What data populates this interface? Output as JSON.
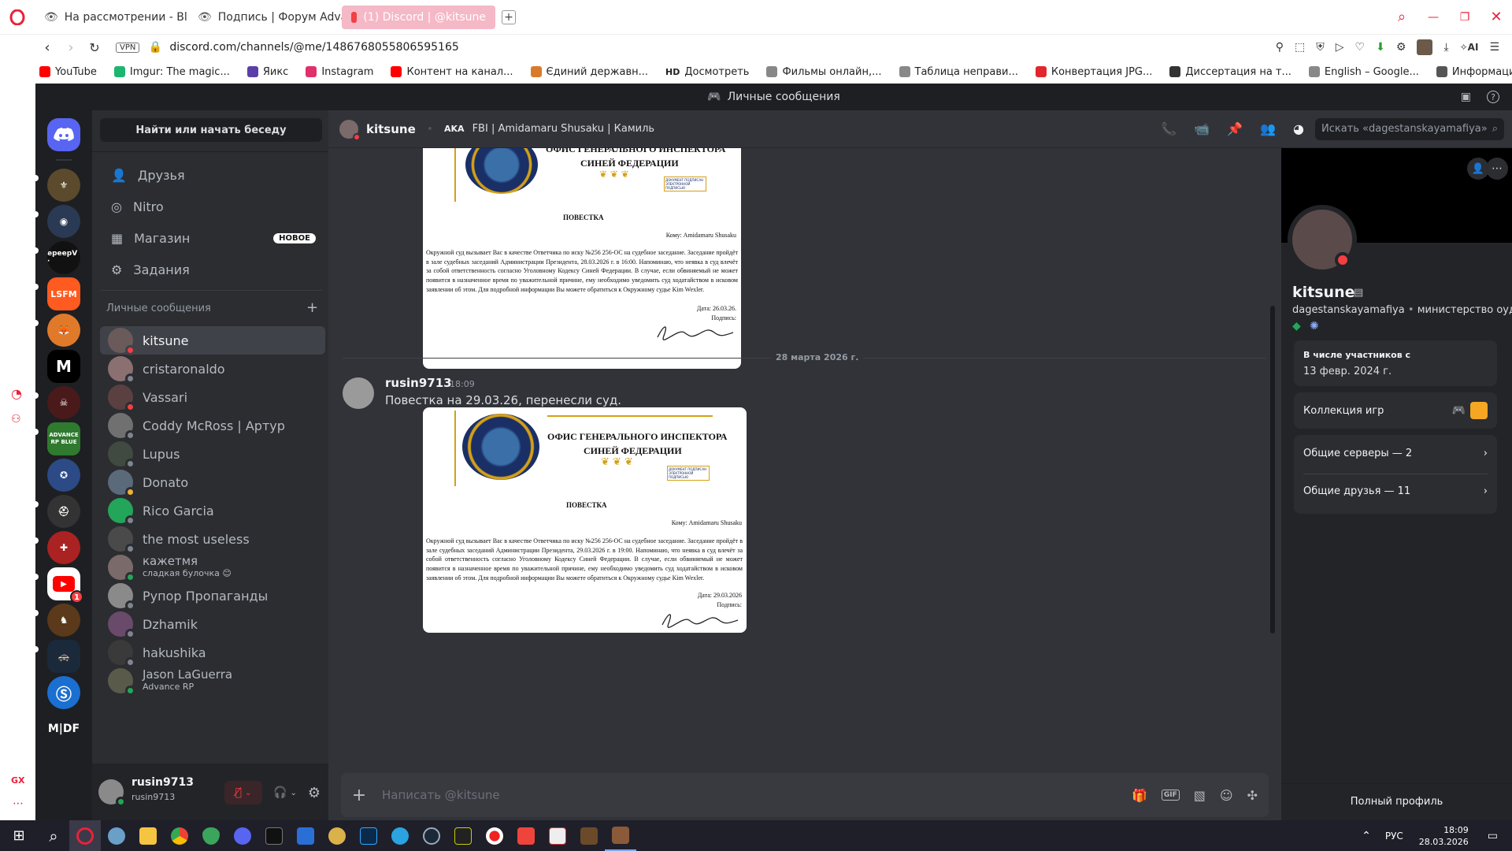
{
  "browser": {
    "tabs": [
      {
        "label": "На рассмотрении - Blue"
      },
      {
        "label": "Подпись | Форум Advanc"
      },
      {
        "label": "(1) Discord | @kitsune"
      }
    ],
    "url": "discord.com/channels/@me/1486768055806595165",
    "vpn": "VPN",
    "bookmarks": [
      {
        "label": "YouTube",
        "color": "#ff0000"
      },
      {
        "label": "Imgur: The magic...",
        "color": "#1bb76e"
      },
      {
        "label": "Яикс",
        "color": "#5b3fa8"
      },
      {
        "label": "Instagram",
        "color": "#e1306c"
      },
      {
        "label": "Контент на канал...",
        "color": "#ff0000"
      },
      {
        "label": "Єдиний державн...",
        "color": "#d97a2b"
      },
      {
        "label": "Досмотреть",
        "color": "#222222",
        "prefix": "HD"
      },
      {
        "label": "Фильмы онлайн,...",
        "color": "#888888"
      },
      {
        "label": "Таблица неправи...",
        "color": "#888888"
      },
      {
        "label": "Конвертация JPG...",
        "color": "#e2262c"
      },
      {
        "label": "Диссертация на т...",
        "color": "#333333"
      },
      {
        "label": "English – Google...",
        "color": "#888888"
      },
      {
        "label": "Информация об а...",
        "color": "#555555"
      }
    ],
    "ai_label": "AI",
    "gx_label": "GX"
  },
  "discord": {
    "window_title": "Личные сообщения",
    "search_placeholder": "Найти или начать беседу",
    "nav": [
      {
        "label": "Друзья",
        "icon": "friends-icon"
      },
      {
        "label": "Nitro",
        "icon": "nitro-icon"
      },
      {
        "label": "Магазин",
        "icon": "shop-icon",
        "badge": "НОВОЕ"
      },
      {
        "label": "Задания",
        "icon": "quests-icon"
      }
    ],
    "dm_header": "Личные сообщения",
    "dms": [
      {
        "name": "kitsune",
        "status": "dnd",
        "active": true
      },
      {
        "name": "cristaronaldo",
        "status": "offline"
      },
      {
        "name": "Vassari",
        "status": "dnd"
      },
      {
        "name": "Coddy McRoss | Артур",
        "status": "offline"
      },
      {
        "name": "Lupus",
        "status": "offline"
      },
      {
        "name": "Donato",
        "status": "idle"
      },
      {
        "name": "Rico Garcia",
        "status": "offline"
      },
      {
        "name": "the most useless",
        "status": "offline"
      },
      {
        "name": "кажетмя",
        "sub": "сладкая булочка 😊",
        "status": "online"
      },
      {
        "name": "Рупор Пропаганды",
        "status": "offline"
      },
      {
        "name": "Dzhamik",
        "status": "offline"
      },
      {
        "name": "hakushika",
        "status": "offline"
      },
      {
        "name": "Jason LaGuerra",
        "sub": "Advance RP",
        "status": "online"
      }
    ],
    "guild_labels": {
      "epeep": "ерeeрV ·",
      "lsfm": "LSFM",
      "m": "M",
      "advance": "ADVANCE RP BLUE",
      "mdf": "M|DF"
    },
    "guild_badge": "1",
    "user": {
      "name": "rusin9713",
      "tag": "rusin9713"
    },
    "header": {
      "name": "kitsune",
      "aka": "AKA",
      "aka_value": "FBI | Amidamaru Shusaku | Камиль",
      "search": "Искать «dagestanskayamafiya»"
    },
    "date_divider": "28 марта 2026 г.",
    "message": {
      "author": "rusin9713",
      "time": "18:09",
      "text": "Повестка на 29.03.26, перенесли суд."
    },
    "doc1": {
      "heading1": "ОФИС ГЕНЕРАЛЬНОГО ИНСПЕКТОРА",
      "heading2": "СИНЕЙ ФЕДЕРАЦИИ",
      "stamp": "ДОКУМЕНТ ПОДПИСАН ЭЛЕКТРОННОЙ ПОДПИСЬЮ",
      "title": "ПОВЕСТКА",
      "to": "Кому: Amidamaru Shusaku",
      "body": "Окружной суд вызывает Вас в качестве Ответчика по иску №256 256-ОС на судебное заседание. Заседание пройдёт в зале судебных заседаний Администрации Президента, 28.03.2026 г. в 16:00. Напоминаю, что неявка в суд влечёт за собой ответственность согласно Уголовному Кодексу Синей Федерации. В случае, если обвиняемый не может появится в назначенное время по уважительной причине, ему необходимо уведомить суд ходатайством в исковом заявлении об этом. Для подробной информации Вы можете обратиться к Окружному судье Kim Wexler.",
      "date": "Дата: 26.03.26.",
      "sign": "Подпись:"
    },
    "doc2": {
      "heading1": "ОФИС ГЕНЕРАЛЬНОГО ИНСПЕКТОРА",
      "heading2": "СИНЕЙ ФЕДЕРАЦИИ",
      "stamp": "ДОКУМЕНТ ПОДПИСАН ЭЛЕКТРОННОЙ ПОДПИСЬЮ",
      "title": "ПОВЕСТКА",
      "to": "Кому: Amidamaru Shusaku",
      "body": "Окружной суд вызывает Вас в качестве Ответчика по иску №256 256-ОС на судебное заседание. Заседание пройдёт в зале судебных заседаний Администрации Президента, 29.03.2026 г. в 19:00. Напоминаю, что неявка в суд влечёт за собой ответственность согласно Уголовному Кодексу Синей Федерации. В случае, если обвиняемый не может появится в назначенное время по уважительной причине, ему необходимо уведомить суд ходатайством в исковом заявлении об этом. Для подробной информации Вы можете обратиться к Окружному судье Kim Wexler.",
      "date": "Дата: 29.03.2026",
      "sign": "Подпись:"
    },
    "compose_placeholder": "Написать @kitsune",
    "profile": {
      "name": "kitsune",
      "handle": "dagestanskayamafiya",
      "pronoun": "министерство оудапа",
      "member_since_label": "В числе участников с",
      "member_since": "13 февр. 2024 г.",
      "games": "Коллекция игр",
      "servers": "Общие серверы — 2",
      "friends": "Общие друзья — 11",
      "full": "Полный профиль"
    }
  },
  "taskbar": {
    "lang": "РУС",
    "time": "18:09",
    "date": "28.03.2026"
  },
  "colors": {
    "blurple": "#5865f2",
    "dnd": "#f23f43",
    "online": "#23a55a",
    "idle": "#f0b232",
    "offline": "#80848e",
    "gold": "#d4a017"
  }
}
